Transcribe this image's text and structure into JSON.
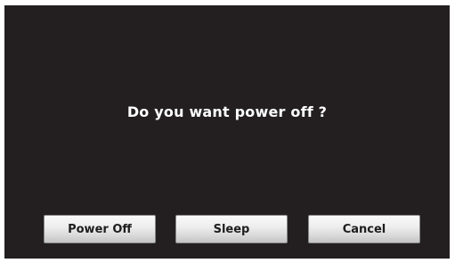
{
  "dialog": {
    "message": "Do you want power off ?",
    "buttons": {
      "power_off": "Power Off",
      "sleep": "Sleep",
      "cancel": "Cancel"
    }
  },
  "colors": {
    "screen_background": "#231f20",
    "message_text": "#ffffff",
    "button_text": "#1e1e1e"
  }
}
